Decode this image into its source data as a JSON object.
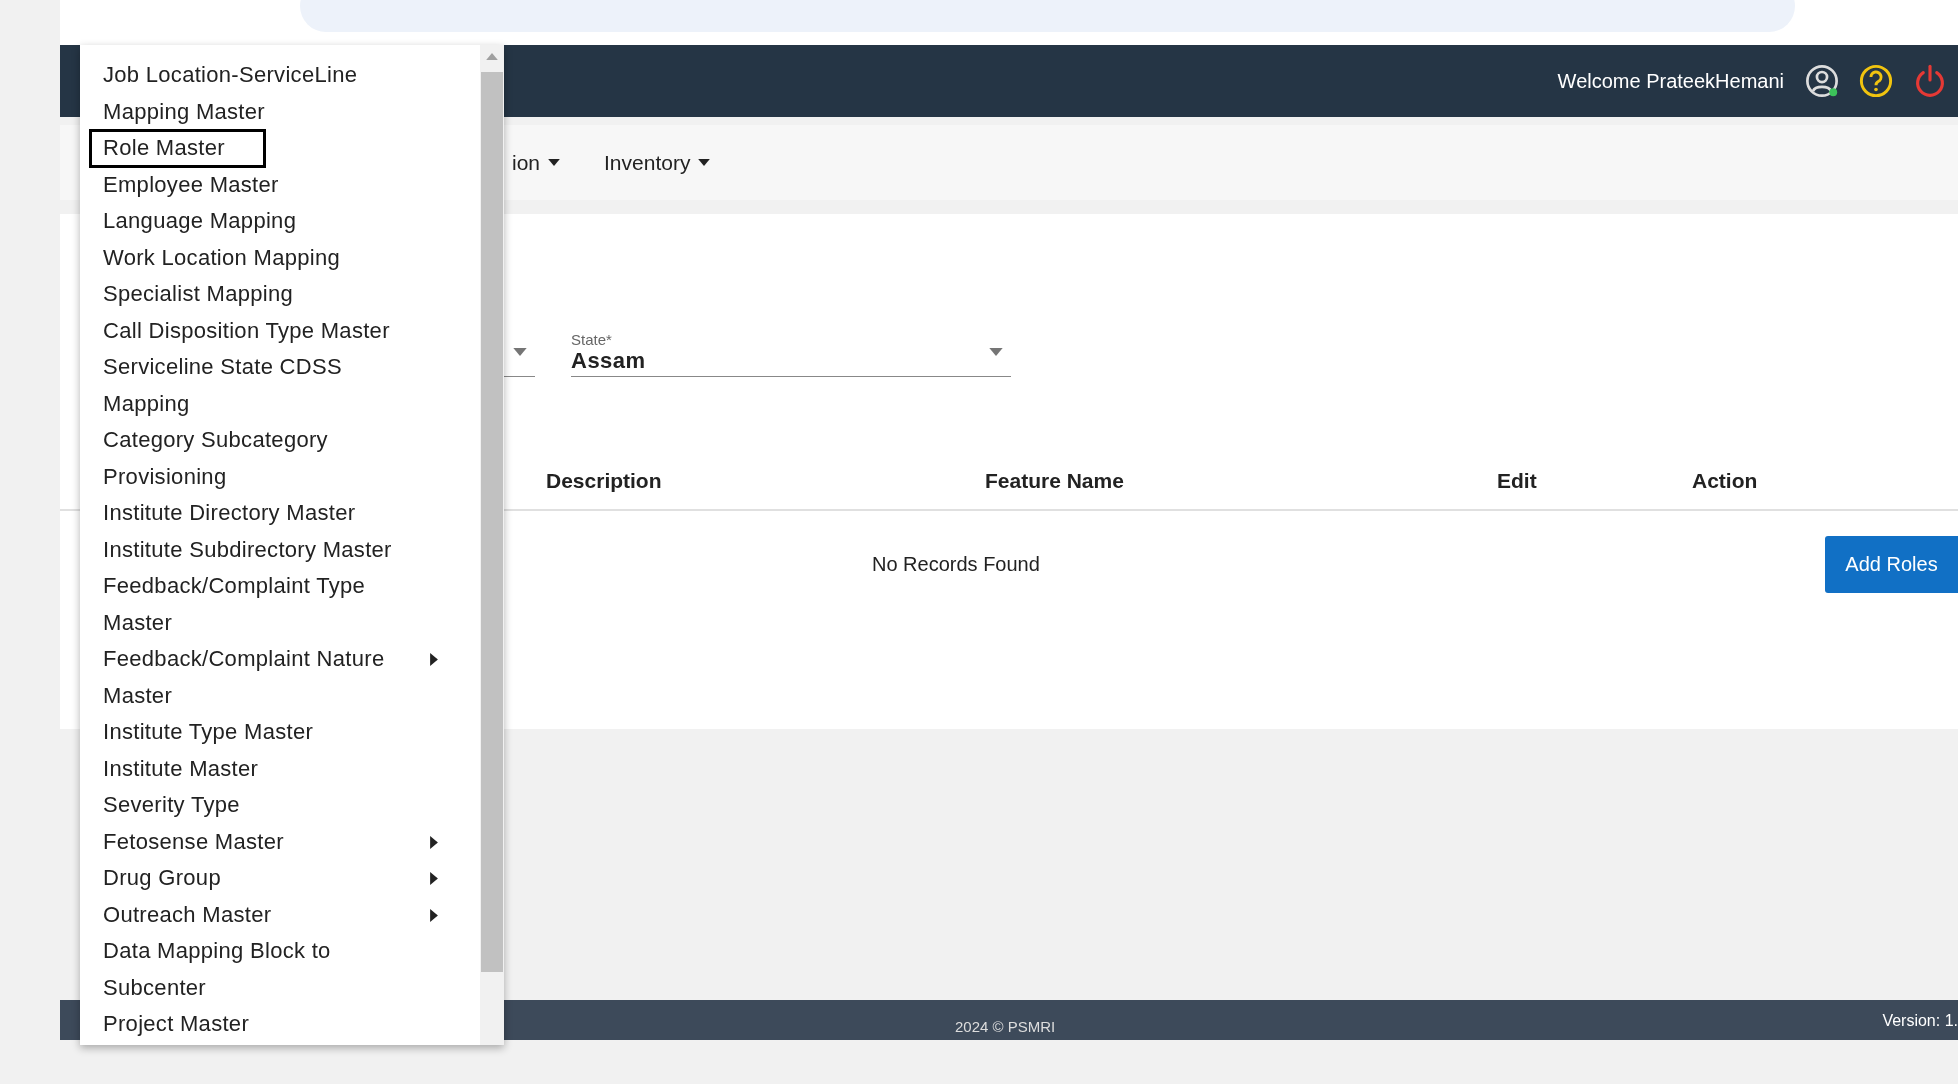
{
  "header": {
    "welcome": "Welcome PrateekHemani"
  },
  "nav": [
    {
      "label": "ion"
    },
    {
      "label": "Inventory"
    }
  ],
  "filters": [
    {
      "label": "State*",
      "value": "Assam"
    }
  ],
  "table": {
    "columns": [
      "Description",
      "Feature Name",
      "Edit",
      "Action"
    ],
    "empty_message": "No Records Found"
  },
  "add_button": "Add Roles",
  "footer": {
    "copyright": "2024 © PSMRI",
    "version": "Version: 1."
  },
  "menu": [
    {
      "label": "Job Location-ServiceLine Mapping Master",
      "kind": "item",
      "selected": false
    },
    {
      "label": "Role Master",
      "kind": "item",
      "selected": true
    },
    {
      "label": "Employee Master",
      "kind": "item",
      "selected": false
    },
    {
      "label": "Language Mapping",
      "kind": "item",
      "selected": false
    },
    {
      "label": "Work Location Mapping",
      "kind": "item",
      "selected": false
    },
    {
      "label": "Specialist Mapping",
      "kind": "item",
      "selected": false
    },
    {
      "label": "Call Disposition Type Master",
      "kind": "item",
      "selected": false
    },
    {
      "label": "Serviceline State CDSS Mapping",
      "kind": "item",
      "selected": false
    },
    {
      "label": "Category Subcategory Provisioning",
      "kind": "item",
      "selected": false
    },
    {
      "label": "Institute Directory Master",
      "kind": "item",
      "selected": false
    },
    {
      "label": "Institute Subdirectory Master",
      "kind": "item",
      "selected": false
    },
    {
      "label": "Feedback/Complaint Type Master",
      "kind": "item",
      "selected": false
    },
    {
      "label": "Feedback/Complaint Nature Master",
      "kind": "submenu",
      "selected": false
    },
    {
      "label": "Institute Type Master",
      "kind": "item",
      "selected": false
    },
    {
      "label": "Institute Master",
      "kind": "item",
      "selected": false
    },
    {
      "label": "Severity Type",
      "kind": "item",
      "selected": false
    },
    {
      "label": "Fetosense Master",
      "kind": "submenu",
      "selected": false
    },
    {
      "label": "Drug Group",
      "kind": "submenu",
      "selected": false
    },
    {
      "label": "Outreach Master",
      "kind": "submenu",
      "selected": false
    },
    {
      "label": "Data Mapping Block to Subcenter",
      "kind": "item",
      "selected": false
    },
    {
      "label": "Project Master",
      "kind": "item",
      "selected": false
    }
  ]
}
